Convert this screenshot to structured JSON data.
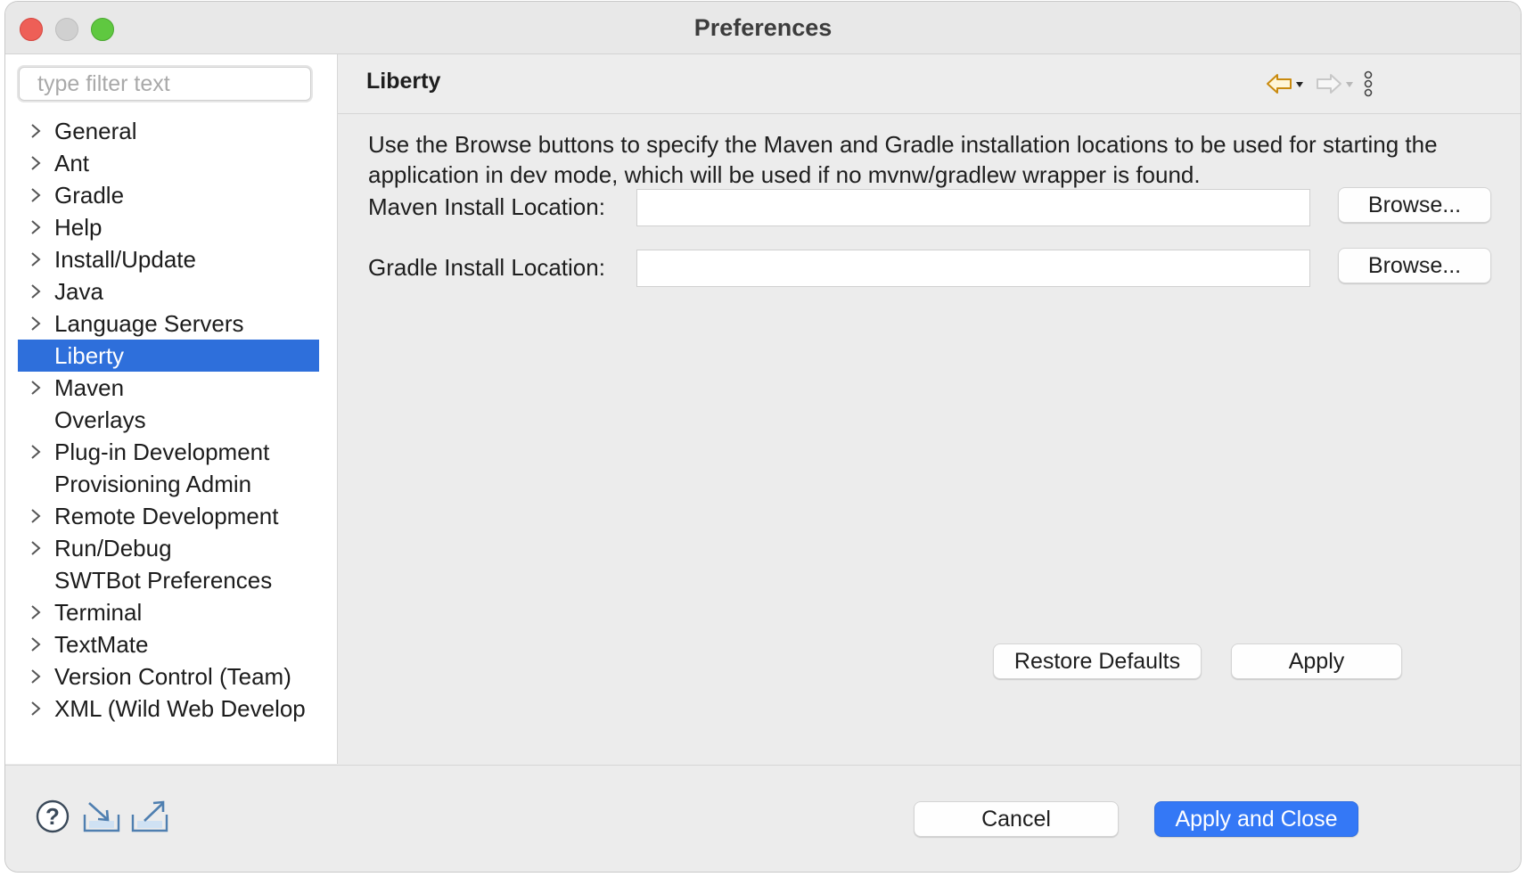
{
  "window": {
    "title": "Preferences"
  },
  "filter": {
    "placeholder": "type filter text",
    "value": ""
  },
  "tree": [
    {
      "label": "General",
      "expandable": true,
      "selected": false
    },
    {
      "label": "Ant",
      "expandable": true,
      "selected": false
    },
    {
      "label": "Gradle",
      "expandable": true,
      "selected": false
    },
    {
      "label": "Help",
      "expandable": true,
      "selected": false
    },
    {
      "label": "Install/Update",
      "expandable": true,
      "selected": false
    },
    {
      "label": "Java",
      "expandable": true,
      "selected": false
    },
    {
      "label": "Language Servers",
      "expandable": true,
      "selected": false
    },
    {
      "label": "Liberty",
      "expandable": false,
      "selected": true
    },
    {
      "label": "Maven",
      "expandable": true,
      "selected": false
    },
    {
      "label": "Overlays",
      "expandable": false,
      "selected": false
    },
    {
      "label": "Plug-in Development",
      "expandable": true,
      "selected": false
    },
    {
      "label": "Provisioning Admin",
      "expandable": false,
      "selected": false
    },
    {
      "label": "Remote Development",
      "expandable": true,
      "selected": false
    },
    {
      "label": "Run/Debug",
      "expandable": true,
      "selected": false
    },
    {
      "label": "SWTBot Preferences",
      "expandable": false,
      "selected": false
    },
    {
      "label": "Terminal",
      "expandable": true,
      "selected": false
    },
    {
      "label": "TextMate",
      "expandable": true,
      "selected": false
    },
    {
      "label": "Version Control (Team)",
      "expandable": true,
      "selected": false
    },
    {
      "label": "XML (Wild Web Develop",
      "expandable": true,
      "selected": false
    }
  ],
  "page": {
    "title": "Liberty",
    "description": "Use the Browse buttons to specify the Maven and Gradle installation locations to be used for starting the application in dev mode, which will be used if no mvnw/gradlew wrapper is found.",
    "maven_label": "Maven Install Location:",
    "maven_value": "",
    "gradle_label": "Gradle Install Location:",
    "gradle_value": "",
    "browse_label": "Browse...",
    "restore_defaults_label": "Restore Defaults",
    "apply_label": "Apply"
  },
  "footer": {
    "cancel_label": "Cancel",
    "apply_close_label": "Apply and Close"
  },
  "icons": {
    "help": "help-icon",
    "import": "import-icon",
    "export": "export-icon",
    "back": "back-arrow-icon",
    "forward": "forward-arrow-icon",
    "menu": "view-menu-icon"
  },
  "colors": {
    "selection": "#2e6fdb",
    "primary_button": "#3478f6",
    "back_arrow": "#d9a21b"
  }
}
